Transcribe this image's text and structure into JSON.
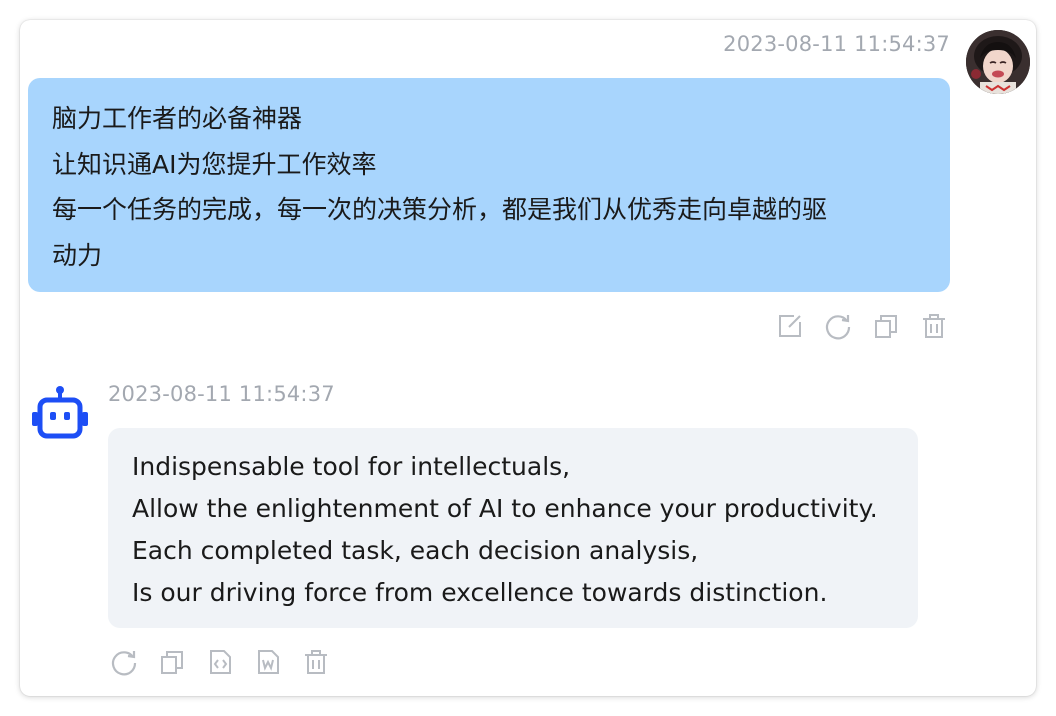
{
  "user_message": {
    "timestamp": "2023-08-11 11:54:37",
    "lines": [
      "脑力工作者的必备神器",
      "让知识通AI为您提升工作效率",
      "每一个任务的完成，每一次的决策分析，都是我们从优秀走向卓越的驱",
      "动力"
    ],
    "actions": [
      "edit-icon",
      "regenerate-icon",
      "copy-icon",
      "delete-icon"
    ]
  },
  "bot_message": {
    "timestamp": "2023-08-11 11:54:37",
    "lines": [
      "Indispensable tool for intellectuals,",
      "Allow the enlightenment of AI to enhance your productivity.",
      "Each completed task, each decision analysis,",
      "Is our driving force from excellence towards distinction."
    ],
    "actions": [
      "regenerate-icon",
      "copy-icon",
      "code-icon",
      "word-export-icon",
      "delete-icon"
    ]
  },
  "colors": {
    "user_bubble": "#a8d5fd",
    "bot_bubble": "#f0f3f7",
    "robot_accent": "#1d4ef5",
    "icon_gray": "#b8bcc2",
    "timestamp_gray": "#a3a8b0"
  }
}
